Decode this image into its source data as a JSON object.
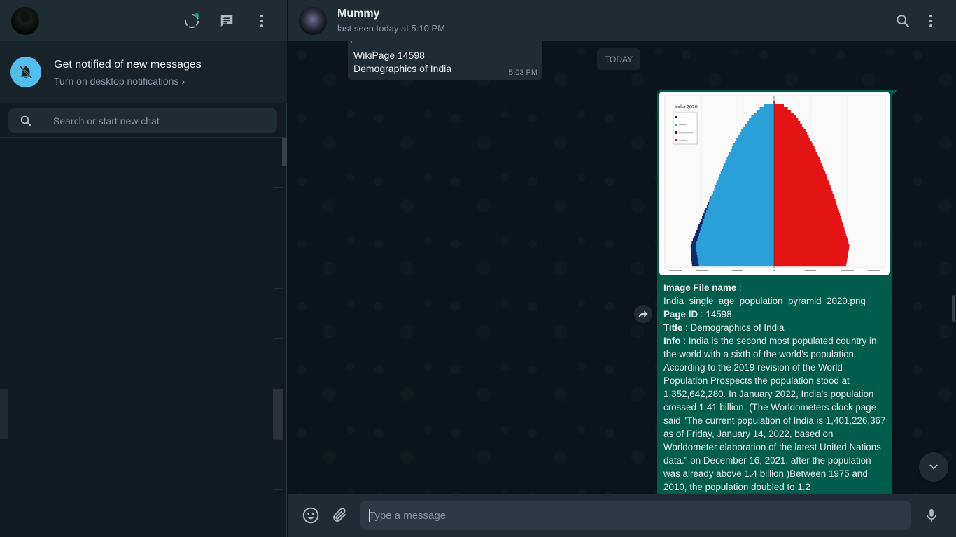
{
  "sidebar": {
    "notification": {
      "title": "Get notified of new messages",
      "link": "Turn on desktop notifications ›"
    },
    "search": {
      "placeholder": "Search or start new chat"
    }
  },
  "chat": {
    "contact_name": "Mummy",
    "contact_status": "last seen today at 5:10 PM",
    "incoming": {
      "line1": "WikiPage 14598",
      "line2": "Demographics of India",
      "time": "5:03 PM"
    },
    "date_chip": "TODAY",
    "outgoing": {
      "image_title": "India 2020",
      "file_label": "Image File name",
      "file_value": "India_single_age_population_pyramid_2020.png",
      "pageid_label": "Page ID",
      "pageid_value": "14598",
      "title_label": "Title",
      "title_value": "Demographics of India",
      "info_label": "Info",
      "info_value": "India is the second most populated country in the world with a sixth of the world's population. According to the 2019 revision of the World Population Prospects the population stood at 1,352,642,280. In January 2022, India's population crossed 1.41 billion. (The Worldometers clock page said \"The current population of India is 1,401,226,367 as of Friday, January 14, 2022, based on Worldometer elaboration of the latest United Nations data.\" on December 16, 2021, after the population was already above 1.4 billion )Between 1975 and 2010, the population doubled to 1.2"
    }
  },
  "composer": {
    "placeholder": "Type a message"
  },
  "icons": {
    "status": "status-icon",
    "new_chat": "new-chat-icon",
    "menu": "menu-icon",
    "bell_off": "bell-off-icon",
    "search": "search-icon",
    "forward": "forward-icon",
    "chevron_down": "chevron-down-icon",
    "emoji": "emoji-icon",
    "attach": "paperclip-icon",
    "mic": "microphone-icon"
  },
  "colors": {
    "accent": "#00a884",
    "outgoing_bubble": "#005c4b",
    "incoming_bubble": "#202c33",
    "panel": "#202c33",
    "background": "#111b21",
    "bell_circle": "#53bdeb"
  }
}
